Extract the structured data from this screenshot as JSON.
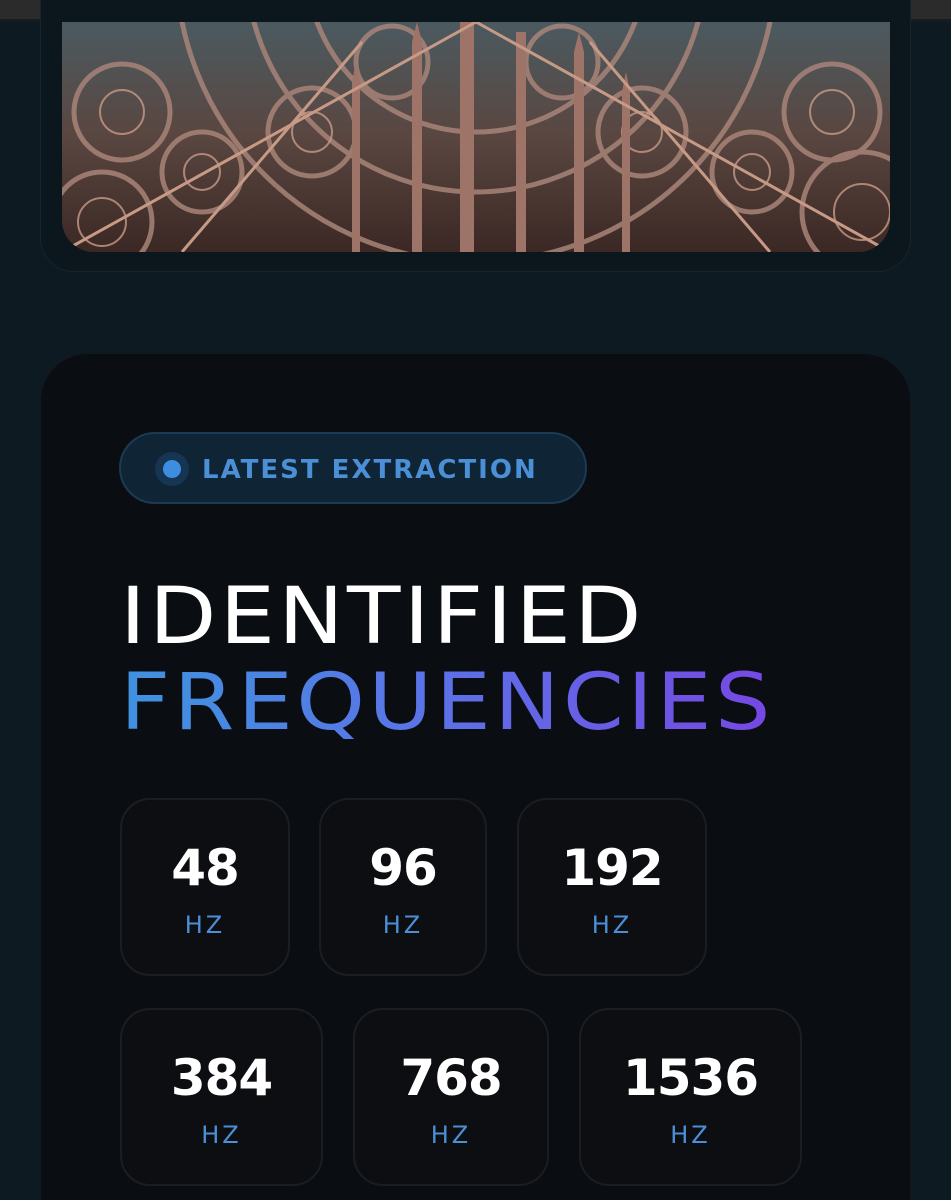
{
  "badge": {
    "label": "LATEST EXTRACTION"
  },
  "heading": {
    "line1": "IDENTIFIED",
    "line2": "FREQUENCIES"
  },
  "frequencies": [
    {
      "value": "48",
      "unit": "HZ"
    },
    {
      "value": "96",
      "unit": "HZ"
    },
    {
      "value": "192",
      "unit": "HZ"
    },
    {
      "value": "384",
      "unit": "HZ"
    },
    {
      "value": "768",
      "unit": "HZ"
    },
    {
      "value": "1536",
      "unit": "HZ"
    }
  ],
  "colors": {
    "accent_blue": "#3f93e0",
    "accent_purple": "#7648e4",
    "panel_bg": "#0a0d12",
    "page_bg": "#0d1a22"
  },
  "image": {
    "subject": "gothic-rose-window-tracery"
  }
}
